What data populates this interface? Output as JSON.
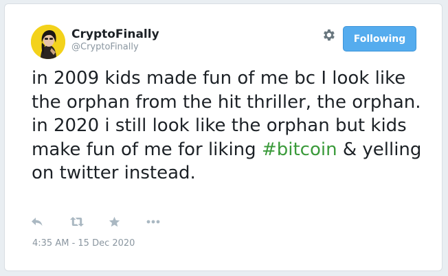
{
  "tweet": {
    "author": {
      "display_name": "CryptoFinally",
      "handle": "@CryptoFinally",
      "avatar_bg": "#f3d21b"
    },
    "follow_button_label": "Following",
    "text_before_hashtag": "in 2009 kids made fun of me bc I look like the orphan from the hit thriller, the orphan. in 2020 i still look like the orphan but kids make fun of me for liking ",
    "hashtag": "#bitcoin",
    "text_after_hashtag": " & yelling on twitter instead.",
    "timestamp": "4:35 AM - 15 Dec 2020",
    "actions": [
      "reply-icon",
      "retweet-icon",
      "like-star-icon",
      "more-dots-icon"
    ]
  },
  "colors": {
    "accent": "#55acee",
    "hashtag": "#3a9a3a",
    "muted": "#8a96a0",
    "text": "#1c2126"
  }
}
